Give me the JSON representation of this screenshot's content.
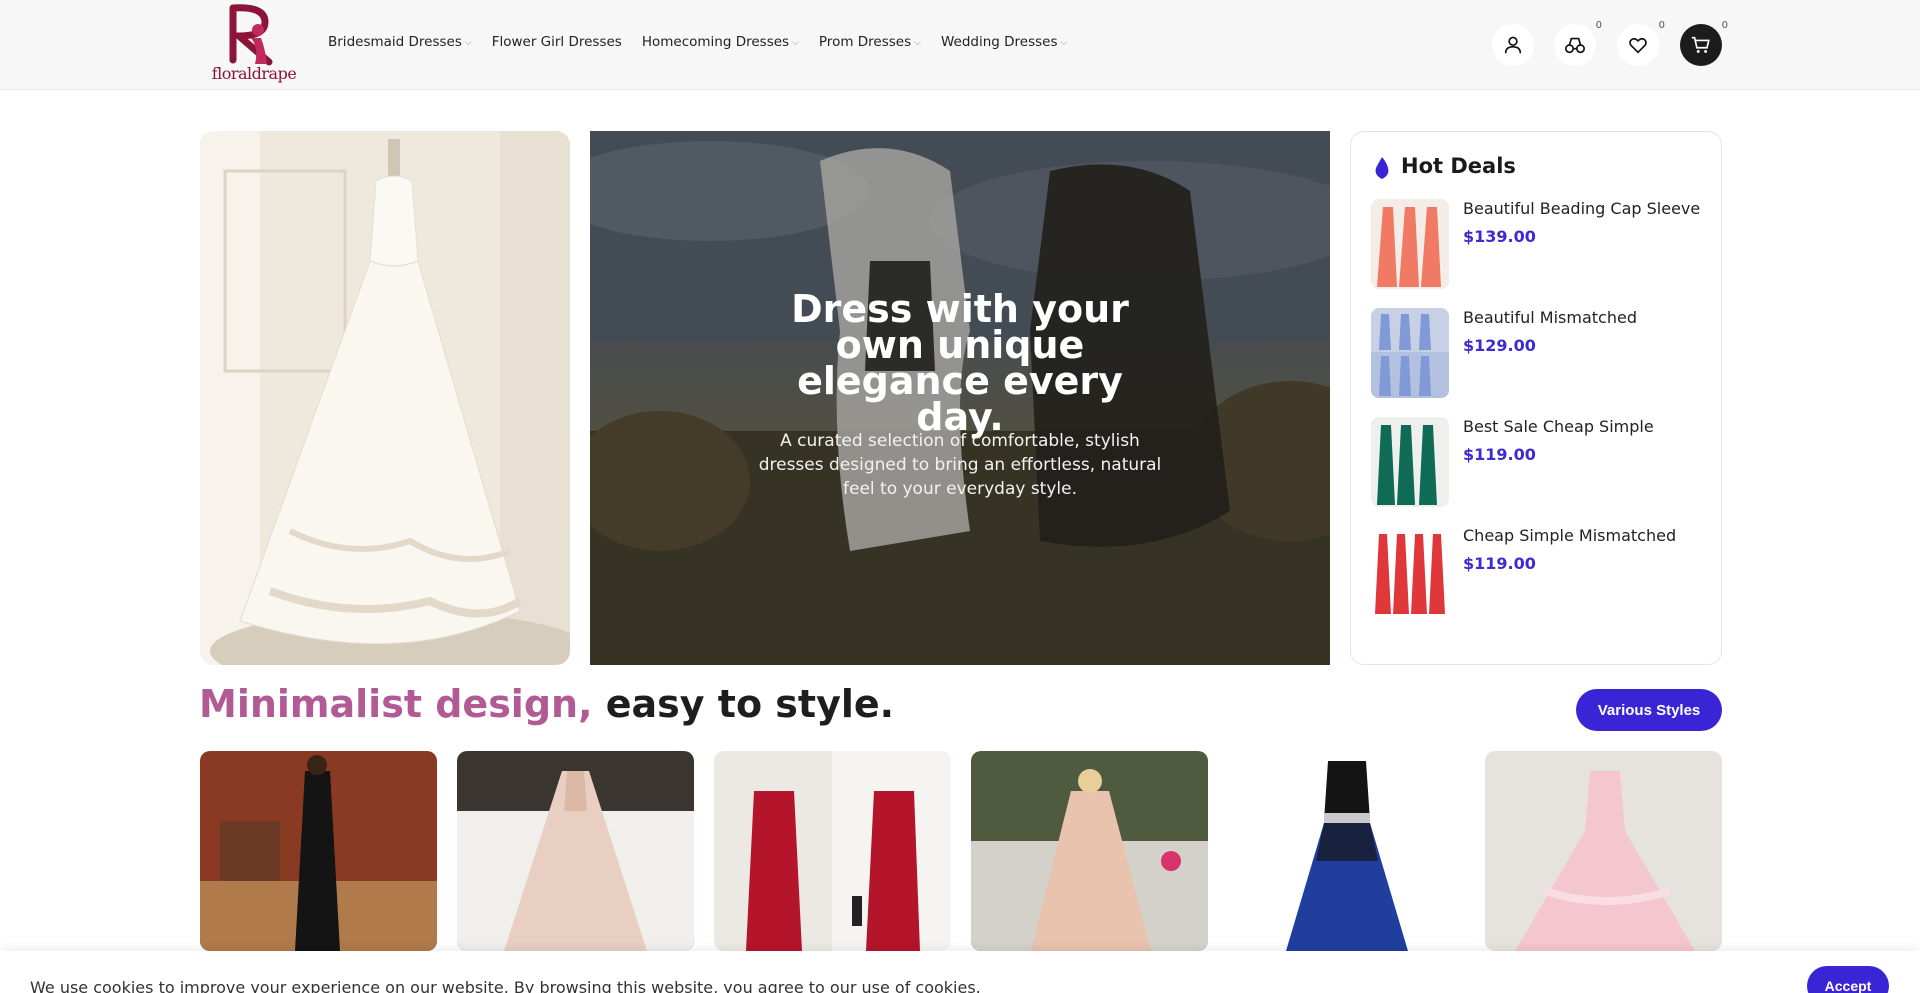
{
  "brand": {
    "logo_text": "floraldrape",
    "accent_color": "#3a25d6",
    "heading_accent_color": "#b25a93"
  },
  "nav": {
    "items": [
      {
        "label": "Bridesmaid Dresses",
        "has_dropdown": true
      },
      {
        "label": "Flower Girl Dresses",
        "has_dropdown": false
      },
      {
        "label": "Homecoming Dresses",
        "has_dropdown": true
      },
      {
        "label": "Prom Dresses",
        "has_dropdown": true
      },
      {
        "label": "Wedding Dresses",
        "has_dropdown": true
      }
    ],
    "chevron": "⌵"
  },
  "header_icons": {
    "account": {
      "icon": "user-icon"
    },
    "compare": {
      "icon": "compare-icon",
      "count": "0"
    },
    "wishlist": {
      "icon": "heart-icon",
      "count": "0"
    },
    "cart": {
      "icon": "cart-icon",
      "count": "0"
    }
  },
  "hero": {
    "headline": "Dress with your own unique elegance every day.",
    "subtext": "A curated selection of comfortable, stylish dresses designed to bring an effortless, natural feel to your everyday style."
  },
  "hot_deals": {
    "title": "Hot Deals",
    "icon": "flame-icon",
    "items": [
      {
        "name": "Beautiful Beading Cap Sleeve",
        "price": "$139.00",
        "dress_color": "#f07a63"
      },
      {
        "name": "Beautiful Mismatched",
        "price": "$129.00",
        "dress_color": "#7f9ad6"
      },
      {
        "name": "Best Sale Cheap Simple",
        "price": "$119.00",
        "dress_color": "#0f6b55"
      },
      {
        "name": "Cheap Simple Mismatched",
        "price": "$119.00",
        "dress_color": "#e0373a"
      }
    ]
  },
  "section": {
    "title_accent": "Minimalist design,",
    "title_rest": " easy to style.",
    "button_label": "Various Styles"
  },
  "products": [
    {
      "dress_color": "#141414",
      "bg": "#8a3a22"
    },
    {
      "dress_color": "#e9cfc2",
      "bg": "#3a3530"
    },
    {
      "dress_color": "#b5152b",
      "bg": "#ece9e4"
    },
    {
      "dress_color": "#e8c3ae",
      "bg": "#4f5a3e"
    },
    {
      "dress_color": "#1f3e9e",
      "bg": "#ffffff"
    },
    {
      "dress_color": "#f4c6cf",
      "bg": "#e6e3df"
    }
  ],
  "cookie": {
    "text": "We use cookies to improve your experience on our website. By browsing this website, you agree to our use of cookies.",
    "accept_label": "Accept"
  }
}
